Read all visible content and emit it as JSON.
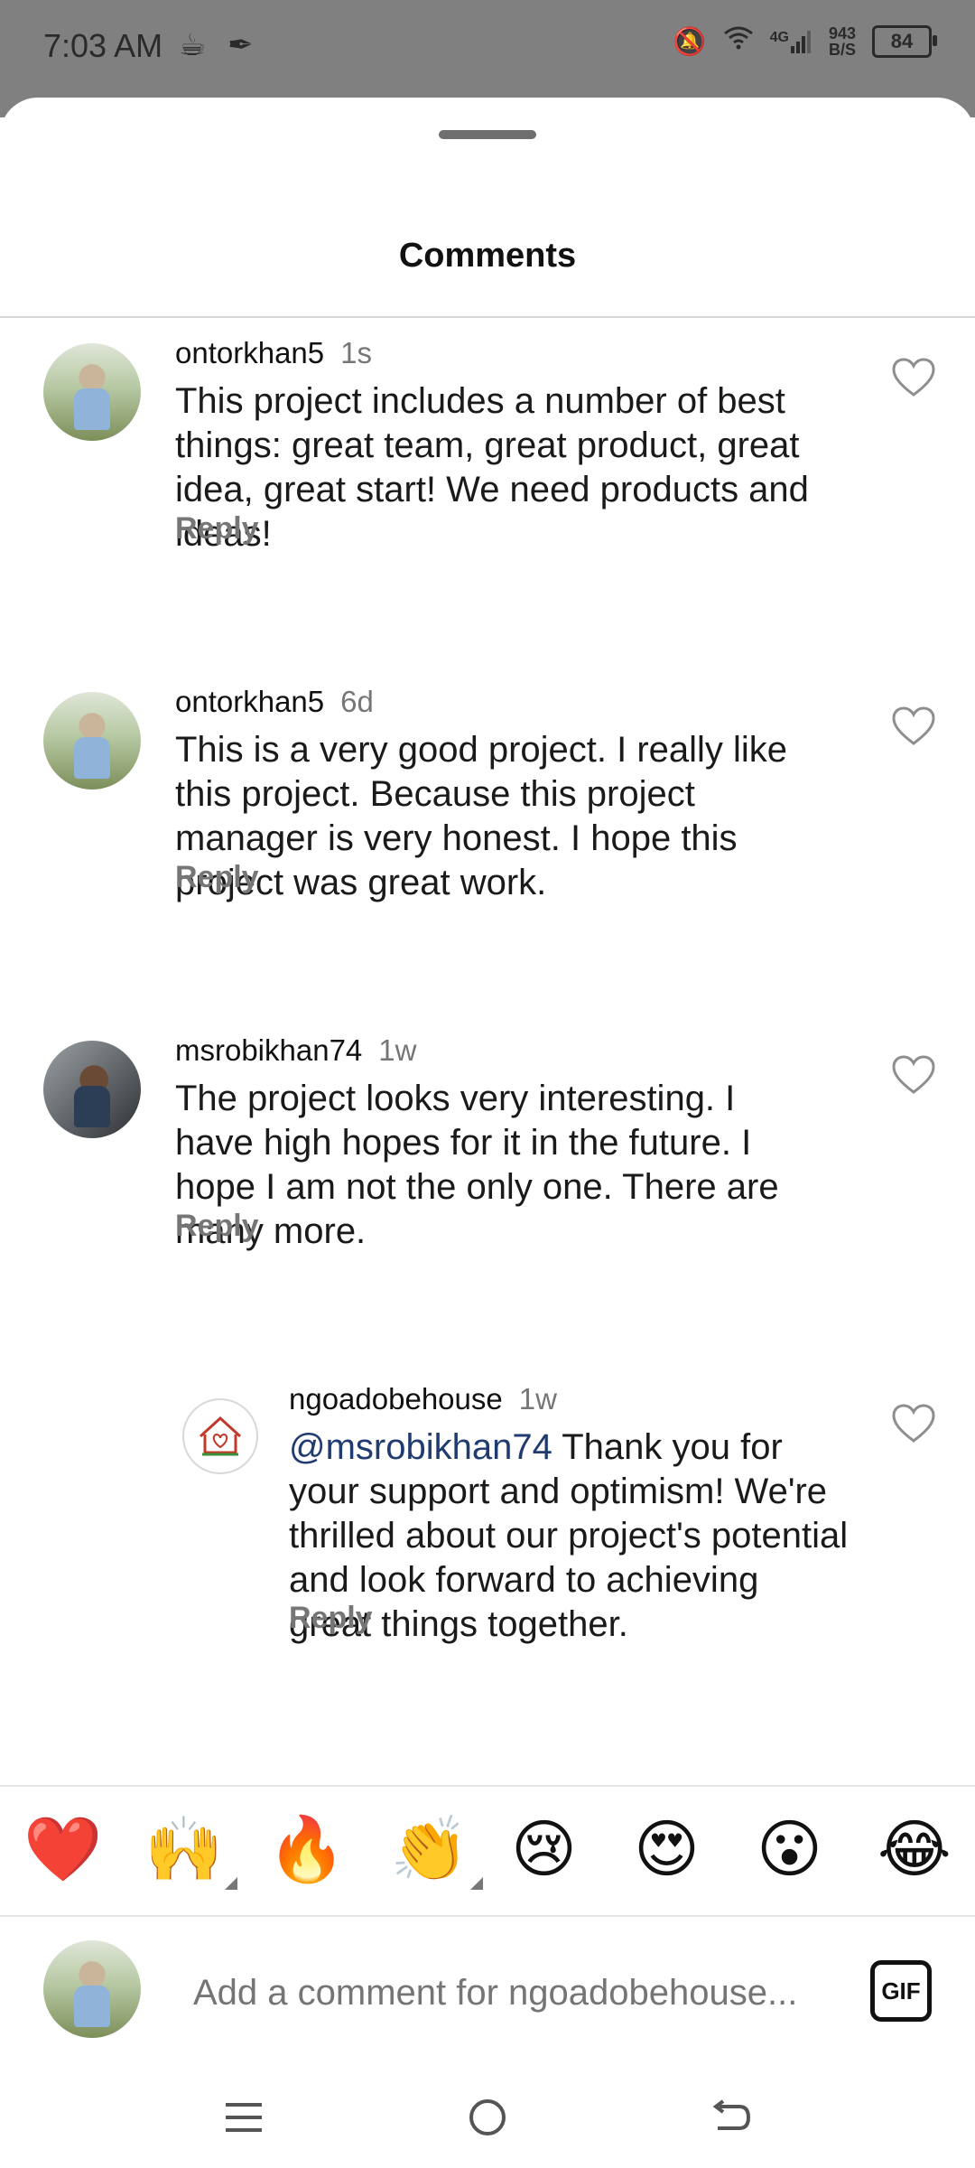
{
  "status_bar": {
    "time": "7:03 AM",
    "network": "4G",
    "speed_value": "943",
    "speed_unit": "B/S",
    "battery": "84",
    "icons": [
      "coffee-icon",
      "feather-icon",
      "bell-muted-icon",
      "wifi-icon",
      "signal-icon",
      "battery-icon"
    ]
  },
  "sheet": {
    "title": "Comments"
  },
  "comments": [
    {
      "username": "ontorkhan5",
      "time": "1s",
      "text": "This project includes a number of best things: great team, great product, great idea, great start! We need products and ideas!",
      "reply_label": "Reply"
    },
    {
      "username": "ontorkhan5",
      "time": "6d",
      "text": "This is a very good project. I really like this project. Because this project manager is very honest. I hope this project was great work.",
      "reply_label": "Reply"
    },
    {
      "username": "msrobikhan74",
      "time": "1w",
      "text": "The project looks very interesting. I have high hopes for it in the future. I hope I am not the only one. There are many more.",
      "reply_label": "Reply"
    },
    {
      "username": "ngoadobehouse",
      "time": "1w",
      "mention": "@msrobikhan74",
      "text": " Thank you for your support and optimism! We're thrilled about our project's potential and look forward to achieving great things together.",
      "reply_label": "Reply"
    }
  ],
  "emoji_bar": [
    "❤️",
    "🙌",
    "🔥",
    "👏",
    "😢",
    "😍",
    "😮",
    "😂"
  ],
  "composer": {
    "placeholder": "Add a comment for ngoadobehouse...",
    "gif_label": "GIF"
  },
  "nav": [
    "menu-icon",
    "home-circle-icon",
    "back-icon"
  ],
  "colors": {
    "mention": "#1f3b70",
    "muted_text": "#767676",
    "status_overlay": "#808080"
  }
}
